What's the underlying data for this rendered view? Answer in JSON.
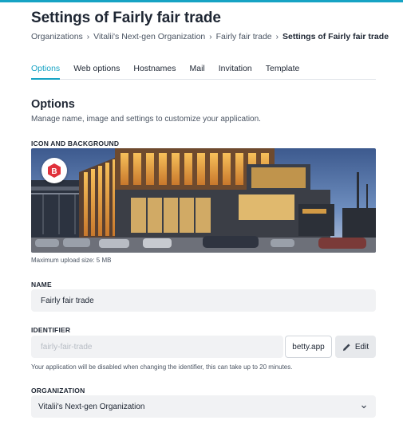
{
  "header": {
    "title": "Settings of Fairly fair trade",
    "breadcrumb": [
      "Organizations",
      "Vitalii's Next-gen Organization",
      "Fairly fair trade",
      "Settings of Fairly fair trade"
    ]
  },
  "tabs": [
    {
      "label": "Options",
      "active": true
    },
    {
      "label": "Web options",
      "active": false
    },
    {
      "label": "Hostnames",
      "active": false
    },
    {
      "label": "Mail",
      "active": false
    },
    {
      "label": "Invitation",
      "active": false
    },
    {
      "label": "Template",
      "active": false
    }
  ],
  "options": {
    "title": "Options",
    "description": "Manage name, image and settings to customize your application."
  },
  "icon_background": {
    "label": "ICON AND BACKGROUND",
    "hint": "Maximum upload size: 5 MB",
    "icon_letter": "B"
  },
  "name": {
    "label": "NAME",
    "value": "Fairly fair trade"
  },
  "identifier": {
    "label": "IDENTIFIER",
    "placeholder": "fairly-fair-trade",
    "domain": "betty.app",
    "edit_label": "Edit",
    "hint": "Your application will be disabled when changing the identifier, this can take up to 20 minutes."
  },
  "organization": {
    "label": "ORGANIZATION",
    "selected": "Vitalii's Next-gen Organization"
  },
  "colors": {
    "accent": "#16a3c4",
    "brand_red": "#e0313b",
    "field_bg": "#f1f2f4"
  }
}
